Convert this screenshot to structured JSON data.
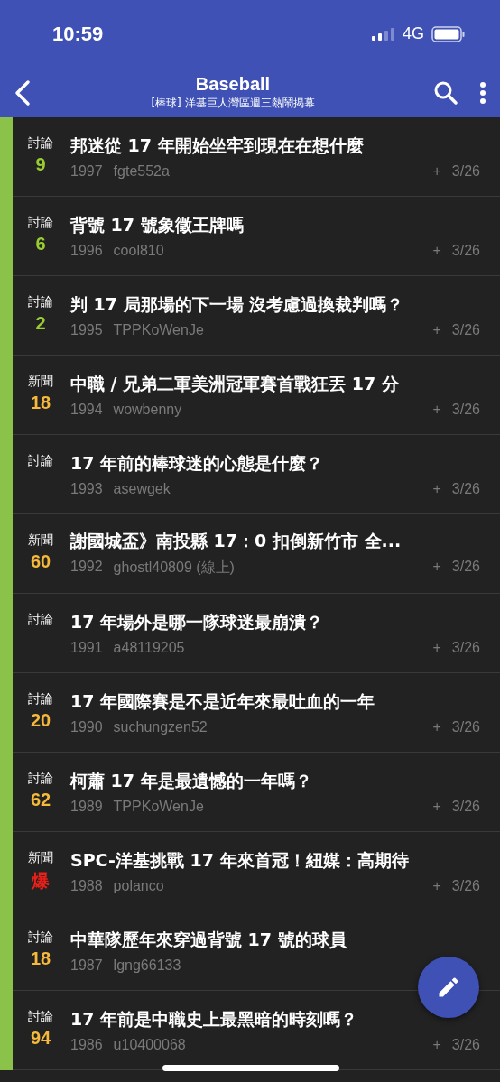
{
  "status_bar": {
    "time": "10:59",
    "network": "4G"
  },
  "header": {
    "title": "Baseball",
    "subtitle": "[棒球] 洋基巨人灣區週三熱鬧揭幕"
  },
  "posts": [
    {
      "category": "討論",
      "score": "9",
      "color": "#9acd32",
      "title": "邦迷從 17 年開始坐牢到現在在想什麼",
      "number": "1997",
      "author": "fgte552a",
      "mark": "+",
      "date": "3/26"
    },
    {
      "category": "討論",
      "score": "6",
      "color": "#9acd32",
      "title": "背號 17 號象徵王牌嗎",
      "number": "1996",
      "author": "cool810",
      "mark": "+",
      "date": "3/26"
    },
    {
      "category": "討論",
      "score": "2",
      "color": "#9acd32",
      "title": "判 17 局那場的下一場 沒考慮過換裁判嗎？",
      "number": "1995",
      "author": "TPPKoWenJe",
      "mark": "+",
      "date": "3/26"
    },
    {
      "category": "新聞",
      "score": "18",
      "color": "#f6b93b",
      "title": "中職 / 兄弟二軍美洲冠軍賽首戰狂丟 17 分",
      "number": "1994",
      "author": "wowbenny",
      "mark": "+",
      "date": "3/26"
    },
    {
      "category": "討論",
      "title": "17 年前的棒球迷的心態是什麼？",
      "number": "1993",
      "author": "asewgek",
      "mark": "+",
      "date": "3/26"
    },
    {
      "category": "新聞",
      "score": "60",
      "color": "#f6b93b",
      "title": "謝國城盃》南投縣 17：0 扣倒新竹市 全...",
      "number": "1992",
      "author": "ghostl40809 (線上)",
      "mark": "+",
      "date": "3/26"
    },
    {
      "category": "討論",
      "title": "17 年場外是哪一隊球迷最崩潰？",
      "number": "1991",
      "author": "a48119205",
      "mark": "+",
      "date": "3/26"
    },
    {
      "category": "討論",
      "score": "20",
      "color": "#f6b93b",
      "title": "17 年國際賽是不是近年來最吐血的一年",
      "number": "1990",
      "author": "suchungzen52",
      "mark": "+",
      "date": "3/26"
    },
    {
      "category": "討論",
      "score": "62",
      "color": "#f6b93b",
      "title": "柯蕭 17 年是最遺憾的一年嗎？",
      "number": "1989",
      "author": "TPPKoWenJe",
      "mark": "+",
      "date": "3/26"
    },
    {
      "category": "新聞",
      "score": "爆",
      "color": "#e8201a",
      "title": "SPC-洋基挑戰 17 年來首冠！紐媒：高期待",
      "number": "1988",
      "author": "polanco",
      "mark": "+",
      "date": "3/26"
    },
    {
      "category": "討論",
      "score": "18",
      "color": "#f6b93b",
      "title": "中華隊歷年來穿過背號 17 號的球員",
      "number": "1987",
      "author": "lgng66133"
    },
    {
      "category": "討論",
      "score": "94",
      "color": "#f6b93b",
      "title": "17 年前是中職史上最黑暗的時刻嗎？",
      "number": "1986",
      "author": "u10400068",
      "mark": "+",
      "date": "3/26"
    }
  ]
}
